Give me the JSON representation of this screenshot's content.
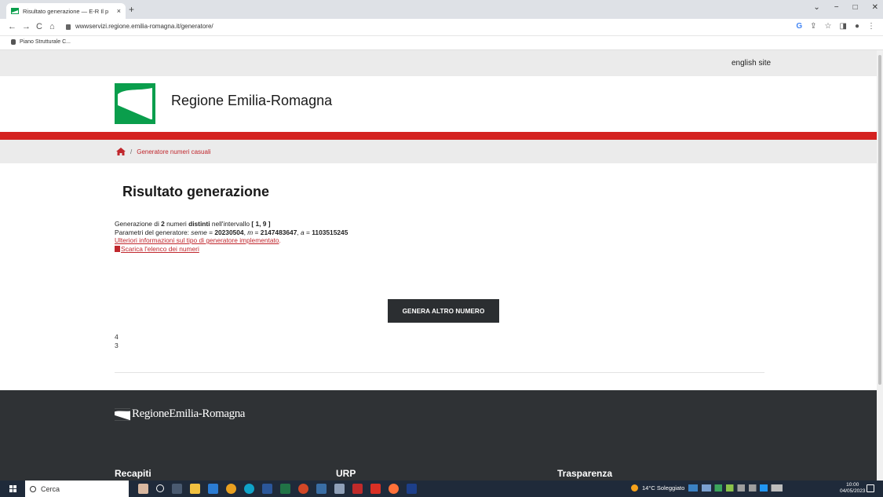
{
  "browser": {
    "tab_title": "Risultato generazione — E-R Il p",
    "tab_close": "×",
    "new_tab": "+",
    "url": "wwwservizi.regione.emilia-romagna.it/generatore/",
    "bookmark": "Piano Strutturale C...",
    "window_controls": [
      "⌄",
      "−",
      "□",
      "✕"
    ],
    "nav": {
      "back": "←",
      "forward": "→",
      "reload": "C",
      "home": "⌂"
    },
    "toolbar_icons": [
      "G",
      "⇪",
      "☆",
      "◨",
      "●",
      "⋮"
    ]
  },
  "site": {
    "english_link": "english site",
    "name": "Regione Emilia-Romagna",
    "accent_red": "#d42220",
    "brand_green": "#0a9e4c"
  },
  "breadcrumb": {
    "separator": "/",
    "current": "Generatore numeri casuali"
  },
  "main": {
    "title": "Risultato generazione",
    "line1": {
      "pre": "Generazione di ",
      "count": "2",
      "mid1": " numeri ",
      "distinct": "distinti",
      "mid2": " nell'intervallo ",
      "range": "[ 1, 9 ]"
    },
    "line2": {
      "pre": "Parametri del generatore: ",
      "seme_label": "seme",
      "eq1": " = ",
      "seme_value": "20230504",
      "sep1": ", ",
      "m_label": "m",
      "eq2": " = ",
      "m_value": "2147483647",
      "sep2": ", ",
      "a_label": "a",
      "eq3": " = ",
      "a_value": "1103515245"
    },
    "info_link": "Ulteriori informazioni sul tipo di generatore implementato",
    "info_link_end": ".",
    "download_link": "Scarica l'elenco dei numeri",
    "generate_button": "GENERA ALTRO NUMERO",
    "numbers": [
      "4",
      "3"
    ]
  },
  "footer": {
    "logo_text": "RegioneEmilia-Romagna",
    "columns": [
      "Recapiti",
      "URP",
      "Trasparenza"
    ]
  },
  "taskbar": {
    "search_placeholder": "Cerca",
    "weather": "14°C Soleggiato",
    "time": "10:00",
    "date": "04/05/2023"
  }
}
